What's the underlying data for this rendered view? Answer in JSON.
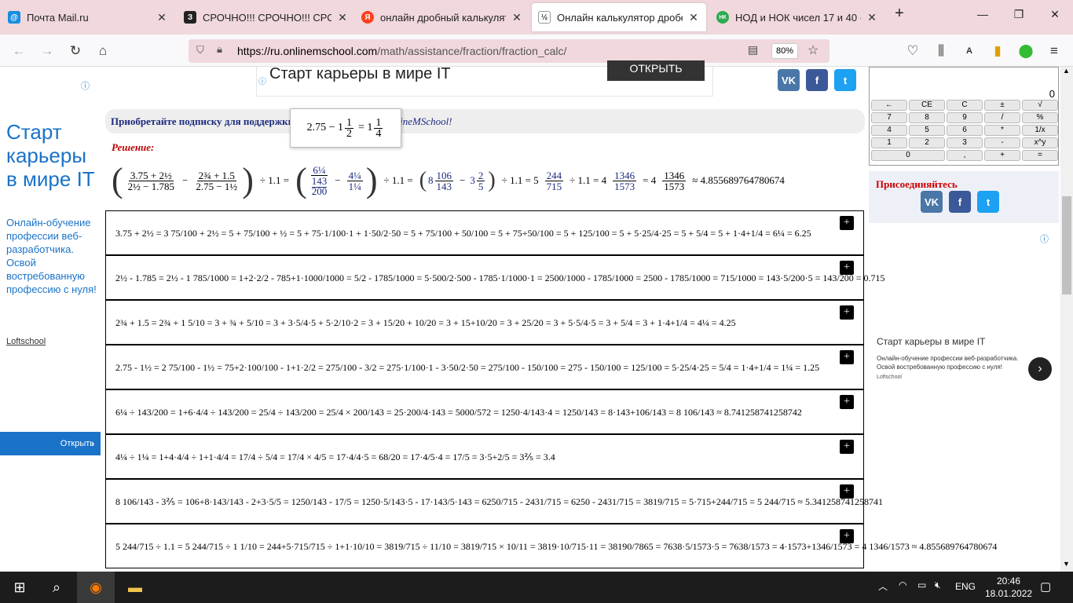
{
  "browser": {
    "tabs": [
      {
        "title": "Почта Mail.ru",
        "color": "#168de2",
        "letter": "@"
      },
      {
        "title": "СРОЧНО!!! СРОЧНО!!! СРОЧН",
        "color": "#222",
        "letter": "З"
      },
      {
        "title": "онлайн дробный калькулятор",
        "color": "#fc3f1d",
        "letter": "Я"
      },
      {
        "title": "Онлайн калькулятор дробей. П",
        "color": "#444",
        "letter": "½"
      },
      {
        "title": "НОД и НОК чисел 17 и 40 - по",
        "color": "#2eaa52",
        "letter": "НК"
      }
    ],
    "new_tab": "+",
    "url_host": "https://ru.onlinemschool.com",
    "url_path": "/math/assistance/fraction/fraction_calc/",
    "zoom": "80%"
  },
  "left_ad": {
    "headline": "Старт карьеры в мире IT",
    "body": "Онлайн-обучение профессии веб-разработчика. Освой востребованную профессию с нуля!",
    "brand": "Loftschool",
    "button": "Открыть"
  },
  "top_ad": {
    "title": "Старт карьеры в мире IT",
    "button": "ОТКРЫТЬ"
  },
  "social": {
    "vk": "VK",
    "fb": "f",
    "tw": "t"
  },
  "subscribe": {
    "text_start": "Приобретайте подписку для поддержки",
    "text_end": "nlineMSchool!"
  },
  "tooltip": {
    "lhs": "2.75 − 1",
    "n1": "1",
    "d1": "2",
    "eq": "= 1",
    "n2": "1",
    "d2": "4"
  },
  "solution_label": "Решение:",
  "main_result": {
    "op1": "÷ 1.1 =",
    "op2": "÷ 1.1 =",
    "op3": "÷ 1.1 = 5",
    "op4": "÷ 1.1 = 4",
    "final": "≈ 4.855689764780674"
  },
  "steps": [
    "3.75 + 2½ = 3 75/100 + 2½ = 5 + 75/100 + ½ = 5 + 75·1/100·1 + 1·50/2·50 = 5 + 75/100 + 50/100 = 5 + 75+50/100 = 5 + 125/100 = 5 + 5·25/4·25 = 5 + 5/4 = 5 + 1·4+1/4 = 6¼ = 6.25",
    "2½ - 1.785 = 2½ - 1 785/1000 = 1+2·2/2 - 785+1·1000/1000 = 5/2 - 1785/1000 = 5·500/2·500 - 1785·1/1000·1 = 2500/1000 - 1785/1000 = 2500 - 1785/1000 = 715/1000 = 143·5/200·5 = 143/200 = 0.715",
    "2¾ + 1.5 = 2¾ + 1 5/10 = 3 + ¾ + 5/10 = 3 + 3·5/4·5 + 5·2/10·2 = 3 + 15/20 + 10/20 = 3 + 15+10/20 = 3 + 25/20 = 3 + 5·5/4·5 = 3 + 5/4 = 3 + 1·4+1/4 = 4¼ = 4.25",
    "2.75 - 1½ = 2 75/100 - 1½ = 75+2·100/100 - 1+1·2/2 = 275/100 - 3/2 = 275·1/100·1 - 3·50/2·50 = 275/100 - 150/100 = 275 - 150/100 = 125/100 = 5·25/4·25 = 5/4 = 1·4+1/4 = 1¼ = 1.25",
    "6¼ ÷ 143/200 = 1+6·4/4 ÷ 143/200 = 25/4 ÷ 143/200 = 25/4 × 200/143 = 25·200/4·143 = 5000/572 = 1250·4/143·4 = 1250/143 = 8·143+106/143 = 8 106/143 ≈ 8.741258741258742",
    "4¼ ÷ 1¼ = 1+4·4/4 ÷ 1+1·4/4 = 17/4 ÷ 5/4 = 17/4 × 4/5 = 17·4/4·5 = 68/20 = 17·4/5·4 = 17/5 = 3·5+2/5 = 3⅖ = 3.4",
    "8 106/143 - 3⅖ = 106+8·143/143 - 2+3·5/5 = 1250/143 - 17/5 = 1250·5/143·5 - 17·143/5·143 = 6250/715 - 2431/715 = 6250 - 2431/715 = 3819/715 = 5·715+244/715 = 5 244/715 ≈ 5.341258741258741",
    "5 244/715 ÷ 1.1 = 5 244/715 ÷ 1 1/10 = 244+5·715/715 ÷ 1+1·10/10 = 3819/715 ÷ 11/10 = 3819/715 × 10/11 = 3819·10/715·11 = 38190/7865 = 7638·5/1573·5 = 7638/1573 = 4·1573+1346/1573 = 4 1346/1573 ≈ 4.855689764780674"
  ],
  "calculator": {
    "display": "0",
    "keys": [
      "←",
      "CE",
      "C",
      "±",
      "√",
      "7",
      "8",
      "9",
      "/",
      "%",
      "4",
      "5",
      "6",
      "*",
      "1/x",
      "1",
      "2",
      "3",
      "-",
      "x^y",
      "0",
      "",
      ",",
      "+",
      "="
    ]
  },
  "join_title": "Присоединяйтесь",
  "right_ad": {
    "title": "Старт карьеры в мире IT",
    "body": "Онлайн-обучение профессии веб-разработчика. Освой востребованную профессию с нуля!",
    "brand": "Loftschool"
  },
  "taskbar": {
    "lang": "ENG",
    "time": "20:46",
    "date": "18.01.2022"
  }
}
